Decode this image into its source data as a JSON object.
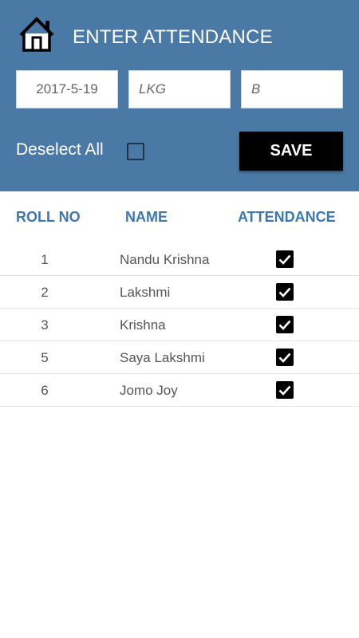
{
  "header": {
    "title": "ENTER ATTENDANCE",
    "home_icon": "home-icon",
    "background_color": "#4a79a5"
  },
  "filters": {
    "date_value": "2017-5-19",
    "class_placeholder": "LKG",
    "division_placeholder": "B"
  },
  "controls": {
    "deselect_label": "Deselect All",
    "deselect_checked": false,
    "save_label": "SAVE"
  },
  "table": {
    "headers": {
      "roll": "ROLL NO",
      "name": "NAME",
      "attendance": "ATTENDANCE"
    },
    "header_color": "#3e77ab",
    "rows": [
      {
        "roll": "1",
        "name": "Nandu Krishna",
        "present": true
      },
      {
        "roll": "2",
        "name": "Lakshmi",
        "present": true
      },
      {
        "roll": "3",
        "name": "Krishna",
        "present": true
      },
      {
        "roll": "5",
        "name": "Saya Lakshmi",
        "present": true
      },
      {
        "roll": "6",
        "name": "Jomo Joy",
        "present": true
      }
    ]
  }
}
